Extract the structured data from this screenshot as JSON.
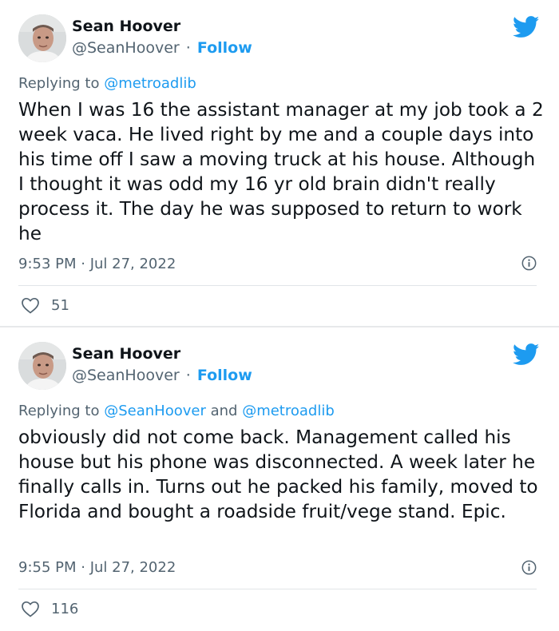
{
  "tweets": [
    {
      "author_name": "Sean Hoover",
      "handle": "@SeanHoover",
      "separator": "·",
      "follow_label": "Follow",
      "replying_prefix": "Replying to",
      "replying_to": [
        "@metroadlib"
      ],
      "replying_joiner": "",
      "text": "When I was 16 the assistant manager at my job took  a 2 week vaca. He lived right by me and a couple days into his time off I saw a moving truck at his house. Although I thought it was odd my 16 yr old brain didn't really process it. The day he was supposed to return to work he",
      "timestamp": "9:53 PM · Jul 27, 2022",
      "likes": "51"
    },
    {
      "author_name": "Sean Hoover",
      "handle": "@SeanHoover",
      "separator": "·",
      "follow_label": "Follow",
      "replying_prefix": "Replying to",
      "replying_to": [
        "@SeanHoover",
        "@metroadlib"
      ],
      "replying_joiner": "and",
      "text": "obviously did not come back. Management called his house but his phone was disconnected. A week later he finally calls in. Turns out he packed his family, moved to Florida and bought a roadside fruit/vege stand. Epic.",
      "timestamp": "9:55 PM · Jul 27, 2022",
      "likes": "116"
    }
  ],
  "icons": {
    "brand": "twitter-bird-icon",
    "info": "info-icon",
    "like": "heart-icon"
  },
  "colors": {
    "brand_blue": "#1d9bf0",
    "secondary_text": "#536471",
    "primary_text": "#0f1419",
    "divider": "#e7e9eb"
  }
}
